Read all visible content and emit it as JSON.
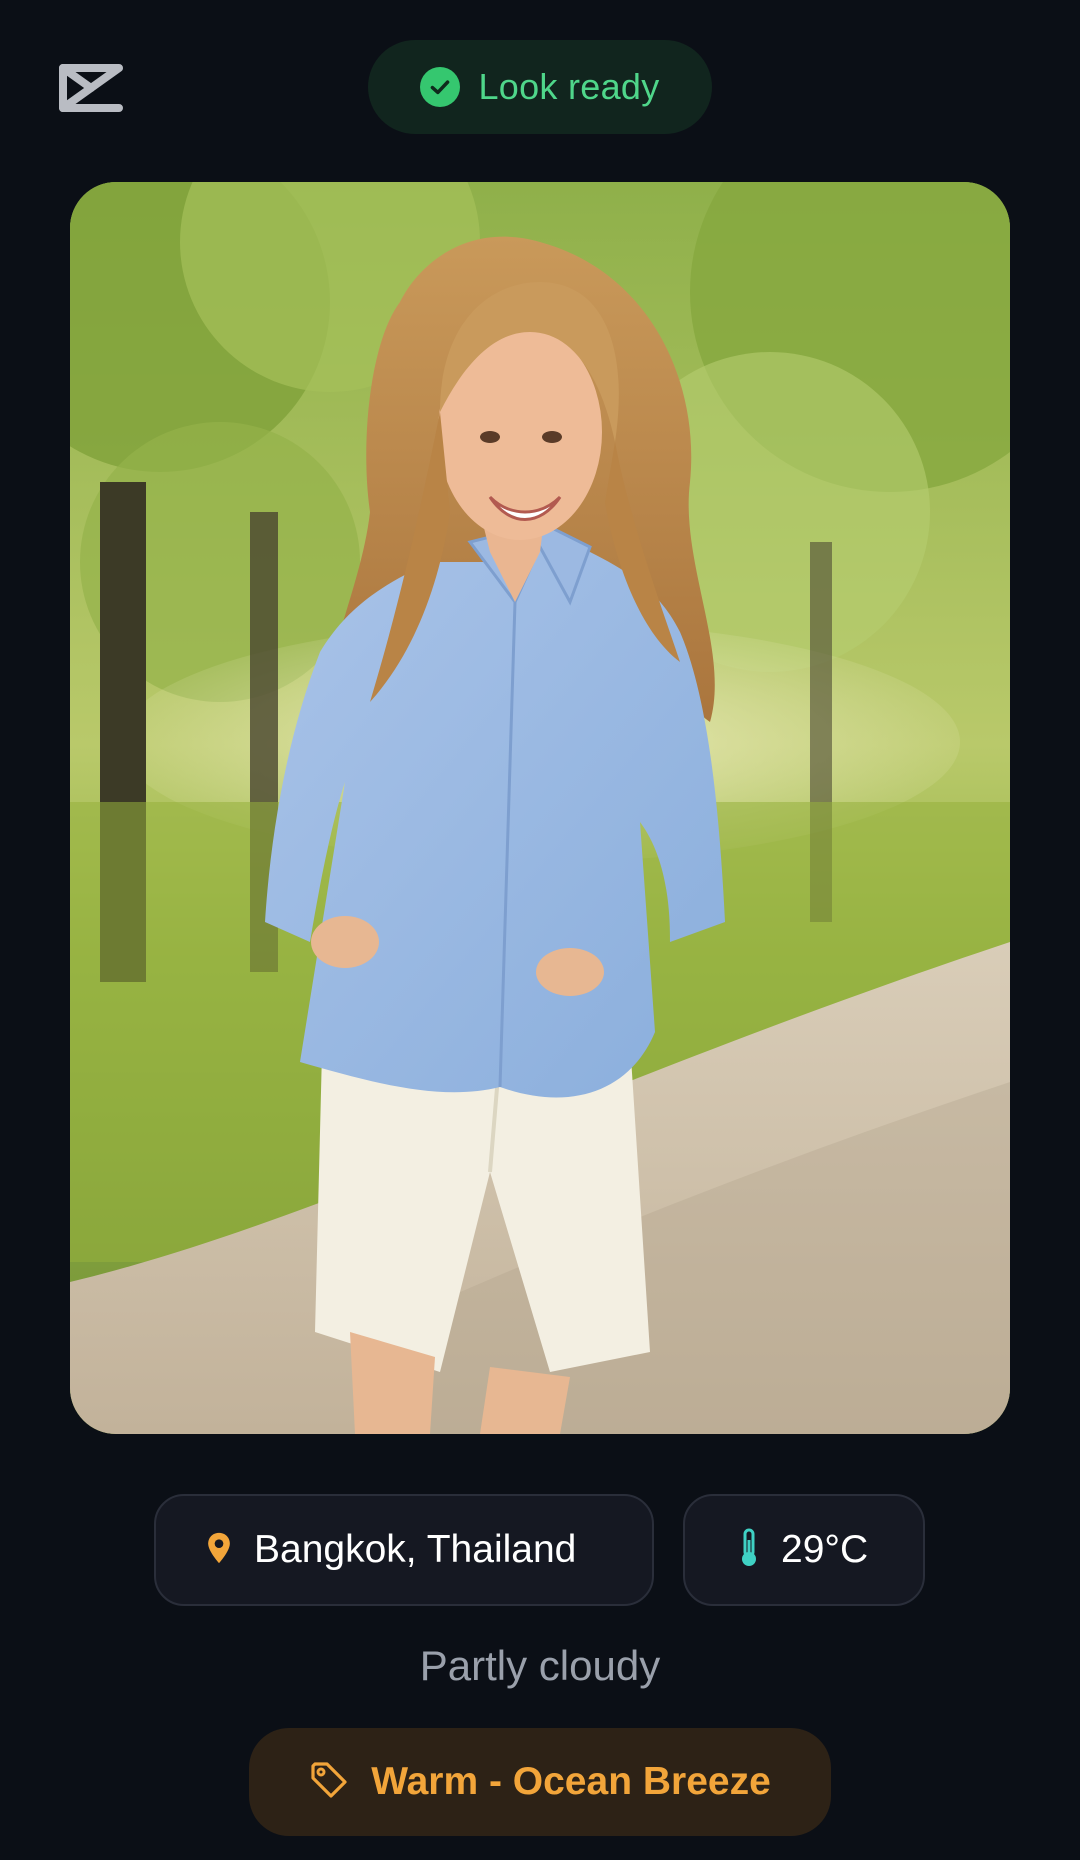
{
  "header": {
    "logo_icon": "app-logo-icon",
    "status": {
      "label": "Look ready",
      "icon": "check-circle-icon",
      "color": "#4fd68a"
    }
  },
  "look": {
    "image_icon": "outfit-photo"
  },
  "weather": {
    "location": "Bangkok, Thailand",
    "location_icon": "map-pin-icon",
    "temperature": "29°C",
    "temperature_icon": "thermometer-icon",
    "condition": "Partly cloudy"
  },
  "style": {
    "tag": "Warm - Ocean Breeze",
    "tag_icon": "tag-icon",
    "accent": "#f2a53a"
  }
}
